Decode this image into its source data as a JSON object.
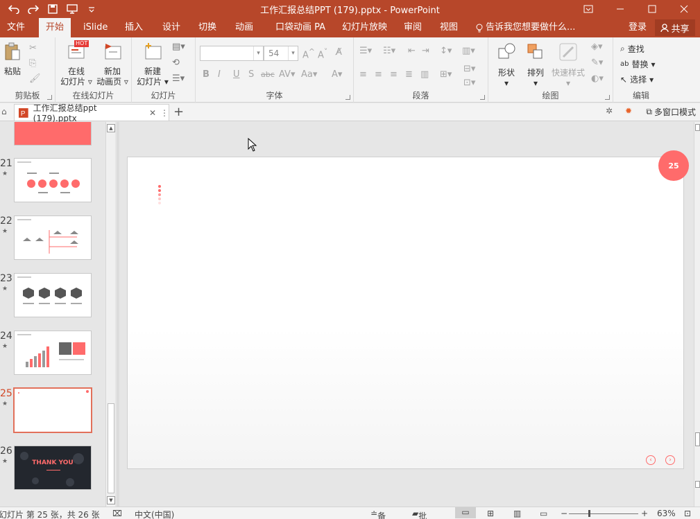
{
  "window": {
    "title": "工作汇报总结PPT (179).pptx - PowerPoint"
  },
  "tabs": [
    "文件",
    "开始",
    "iSlide",
    "插入",
    "设计",
    "切换",
    "动画",
    "口袋动画 PA",
    "幻灯片放映",
    "审阅",
    "视图"
  ],
  "active_tab": "开始",
  "tell_me": "告诉我您想要做什么...",
  "account": {
    "login": "登录",
    "share": "共享"
  },
  "ribbon": {
    "clipboard": {
      "paste": "粘贴",
      "group": "剪贴板"
    },
    "online": {
      "online_slides_1": "在线",
      "online_slides_2": "幻灯片",
      "new_anim_1": "新加",
      "new_anim_2": "动画页",
      "group": "在线幻灯片",
      "hot": "HOT"
    },
    "slides": {
      "new_slide_1": "新建",
      "new_slide_2": "幻灯片",
      "group": "幻灯片"
    },
    "font": {
      "font_name": "",
      "font_size": "54",
      "group": "字体"
    },
    "paragraph": {
      "group": "段落"
    },
    "drawing": {
      "shape": "形状",
      "arrange": "排列",
      "quick_style": "快速样式",
      "group": "绘图"
    },
    "editing": {
      "find": "查找",
      "replace": "替换",
      "select": "选择",
      "group": "编辑"
    }
  },
  "doc_tab": {
    "name": "工作汇报总结ppt (179).pptx",
    "multi_window": "多窗口模式"
  },
  "thumbnails": [
    {
      "num": "21",
      "selected": false
    },
    {
      "num": "22",
      "selected": false
    },
    {
      "num": "23",
      "selected": false
    },
    {
      "num": "24",
      "selected": false
    },
    {
      "num": "25",
      "selected": true
    },
    {
      "num": "26",
      "selected": false
    }
  ],
  "thumb_26_text": "THANK YOU",
  "slide": {
    "page_badge": "25"
  },
  "status": {
    "slide_info": "幻灯片 第 25 张，共 26 张",
    "language": "中文(中国)",
    "notes": "备注",
    "comments": "批注",
    "zoom": "63%"
  },
  "colors": {
    "accent": "#b7472a",
    "slide_accent": "#ff6b6b"
  }
}
